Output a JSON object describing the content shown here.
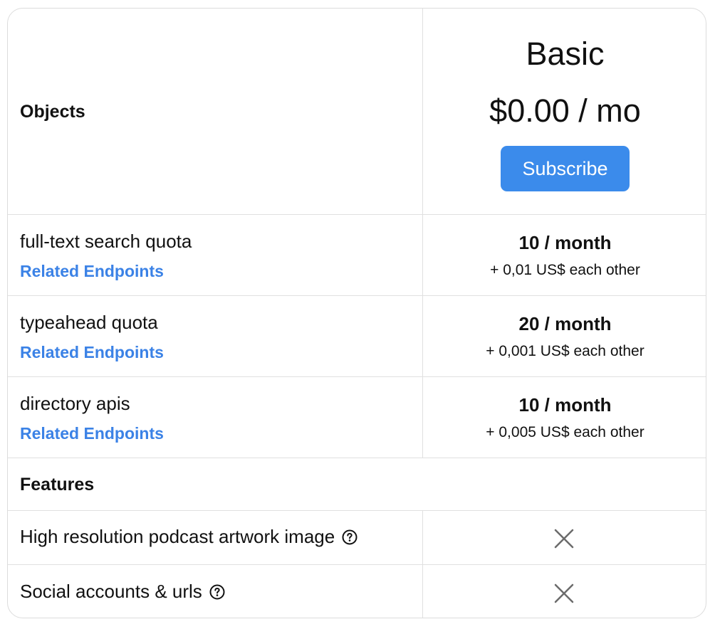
{
  "header": {
    "objects_label": "Objects",
    "plan_name": "Basic",
    "price": "$0.00 / mo",
    "subscribe_label": "Subscribe"
  },
  "rows": [
    {
      "name": "full-text search quota",
      "link": "Related Endpoints",
      "quota": "10 / month",
      "extra": "+ 0,01 US$ each other"
    },
    {
      "name": "typeahead quota",
      "link": "Related Endpoints",
      "quota": "20 / month",
      "extra": "+ 0,001 US$ each other"
    },
    {
      "name": "directory apis",
      "link": "Related Endpoints",
      "quota": "10 / month",
      "extra": "+ 0,005 US$ each other"
    }
  ],
  "features": {
    "section_label": "Features",
    "items": [
      {
        "name": "High resolution podcast artwork image",
        "included": false
      },
      {
        "name": "Social accounts & urls",
        "included": false
      }
    ]
  },
  "icons": {
    "help": "help-circle-icon",
    "excluded": "x-icon"
  },
  "colors": {
    "accent": "#3b8beb",
    "link": "#3b82e6",
    "border": "#e0e0e0"
  }
}
